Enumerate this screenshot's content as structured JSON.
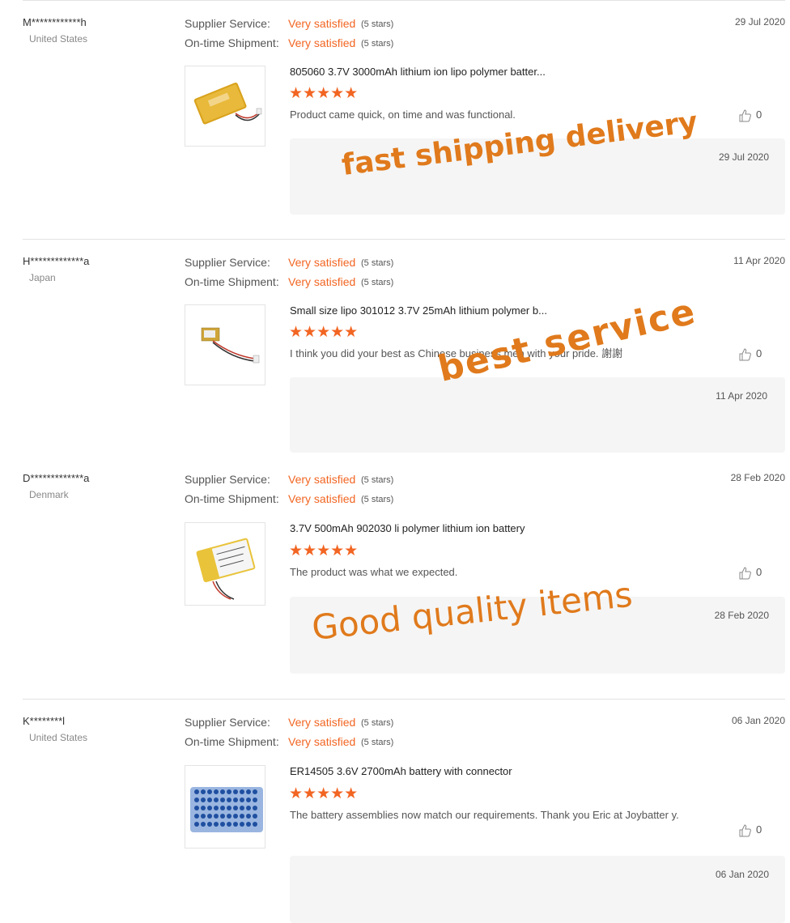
{
  "labels": {
    "supplier_service": "Supplier Service:",
    "ontime_shipment": "On-time Shipment:"
  },
  "colors": {
    "accent": "#f26522",
    "watermark": "#e07a1c",
    "box_bg": "#f5f5f5"
  },
  "icons": {
    "star": "star-icon",
    "like": "thumbs-up-icon"
  },
  "reviews": [
    {
      "buyer": "M************h",
      "country": "United States",
      "supplier_service": "Very satisfied",
      "supplier_stars": "(5 stars)",
      "shipment": "Very satisfied",
      "shipment_stars": "(5 stars)",
      "date": "29 Jul 2020",
      "product": "805060 3.7V 3000mAh lithium ion lipo polymer batter...",
      "stars": "★★★★★",
      "comment": "Product came quick, on time and was functional.",
      "likes": "0",
      "feedback_date": "29 Jul 2020",
      "watermark": "fast shipping delivery"
    },
    {
      "buyer": "H*************a",
      "country": "Japan",
      "supplier_service": "Very satisfied",
      "supplier_stars": "(5 stars)",
      "shipment": "Very satisfied",
      "shipment_stars": "(5 stars)",
      "date": "11 Apr 2020",
      "product": "Small size lipo 301012 3.7V 25mAh lithium polymer b...",
      "stars": "★★★★★",
      "comment": "I think you did your best as Chinese business men with your pride. 謝謝",
      "likes": "0",
      "feedback_date": "11 Apr 2020",
      "watermark": "best service"
    },
    {
      "buyer": "D*************a",
      "country": "Denmark",
      "supplier_service": "Very satisfied",
      "supplier_stars": "(5 stars)",
      "shipment": "Very satisfied",
      "shipment_stars": "(5 stars)",
      "date": "28 Feb 2020",
      "product": "3.7V 500mAh 902030 li polymer lithium ion battery",
      "stars": "★★★★★",
      "comment": "The product was what we expected.",
      "likes": "0",
      "feedback_date": "28 Feb 2020",
      "watermark": "Good quality items"
    },
    {
      "buyer": "K********l",
      "country": "United States",
      "supplier_service": "Very satisfied",
      "supplier_stars": "(5 stars)",
      "shipment": "Very satisfied",
      "shipment_stars": "(5 stars)",
      "date": "06 Jan 2020",
      "product": "ER14505 3.6V 2700mAh battery with connector",
      "stars": "★★★★★",
      "comment": "The battery assemblies now match our requirements. Thank you Eric at Joybatter y.",
      "likes": "0",
      "feedback_date": "06 Jan 2020",
      "watermark": ""
    }
  ]
}
